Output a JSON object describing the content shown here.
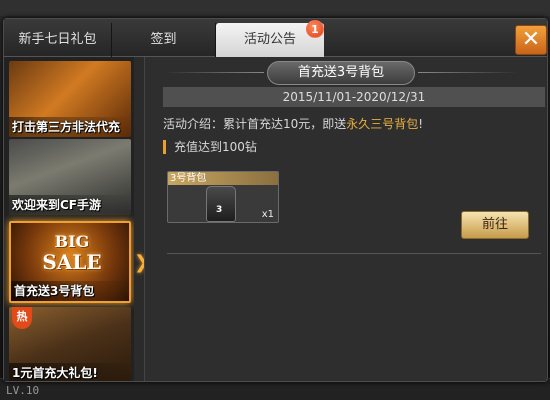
{
  "tabs": [
    {
      "label": "新手七日礼包"
    },
    {
      "label": "签到"
    },
    {
      "label": "活动公告"
    }
  ],
  "tab_badge": "1",
  "close_label": "✕",
  "sidebar": {
    "banners": [
      {
        "caption": "打击第三方非法代充"
      },
      {
        "caption": "欢迎来到CF手游"
      },
      {
        "caption": "首充送3号背包",
        "big_sale_top": "BIG",
        "big_sale_bottom": "SALE"
      },
      {
        "caption": "1元首充大礼包!",
        "tag": "热"
      }
    ],
    "selector_arrow": "❯❯"
  },
  "content": {
    "title": "首充送3号背包",
    "date_range": "2015/11/01-2020/12/31",
    "intro_prefix": "活动介绍：累计首充达10元，即送",
    "intro_highlight": "永久三号背包",
    "intro_suffix": "!",
    "section_label": "充值达到100钻",
    "reward": {
      "name": "3号背包",
      "bag_number": "3",
      "quantity": "x1"
    },
    "go_button": "前往"
  },
  "footer": {
    "level": "LV.10"
  },
  "colors": {
    "accent": "#e8a030",
    "highlight_text": "#e8b040",
    "badge": "#e0401a",
    "close": "#e07a20"
  }
}
